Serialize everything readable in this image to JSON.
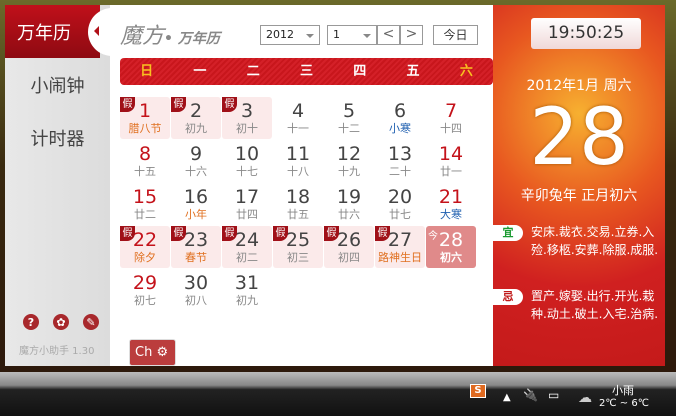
{
  "sidebar": {
    "items": [
      {
        "label": "万年历"
      },
      {
        "label": "小闹钟"
      },
      {
        "label": "计时器"
      }
    ],
    "version": "魔方小助手 1.30"
  },
  "header": {
    "logo": "魔方",
    "logo_sub": "• 万年历",
    "year": "2012",
    "month": "1",
    "prev": "<",
    "next": ">",
    "today": "今日"
  },
  "weekdays": [
    "日",
    "一",
    "二",
    "三",
    "四",
    "五",
    "六"
  ],
  "holiday_badge": "假",
  "today_badge": "今",
  "days": [
    {
      "d": "1",
      "l": "腊八节",
      "t": "fest",
      "hol": true,
      "red": true
    },
    {
      "d": "2",
      "l": "初九",
      "hol": true
    },
    {
      "d": "3",
      "l": "初十",
      "hol": true
    },
    {
      "d": "4",
      "l": "十一"
    },
    {
      "d": "5",
      "l": "十二"
    },
    {
      "d": "6",
      "l": "小寒",
      "t": "term"
    },
    {
      "d": "7",
      "l": "十四",
      "red": true
    },
    {
      "d": "8",
      "l": "十五",
      "red": true
    },
    {
      "d": "9",
      "l": "十六"
    },
    {
      "d": "10",
      "l": "十七"
    },
    {
      "d": "11",
      "l": "十八"
    },
    {
      "d": "12",
      "l": "十九"
    },
    {
      "d": "13",
      "l": "二十"
    },
    {
      "d": "14",
      "l": "廿一",
      "red": true
    },
    {
      "d": "15",
      "l": "廿二",
      "red": true
    },
    {
      "d": "16",
      "l": "小年",
      "t": "fest"
    },
    {
      "d": "17",
      "l": "廿四"
    },
    {
      "d": "18",
      "l": "廿五"
    },
    {
      "d": "19",
      "l": "廿六"
    },
    {
      "d": "20",
      "l": "廿七"
    },
    {
      "d": "21",
      "l": "大寒",
      "t": "term",
      "red": true
    },
    {
      "d": "22",
      "l": "除夕",
      "t": "fest",
      "hol": true,
      "red": true
    },
    {
      "d": "23",
      "l": "春节",
      "t": "fest",
      "hol": true
    },
    {
      "d": "24",
      "l": "初二",
      "hol": true
    },
    {
      "d": "25",
      "l": "初三",
      "hol": true
    },
    {
      "d": "26",
      "l": "初四",
      "hol": true
    },
    {
      "d": "27",
      "l": "路神生日",
      "t": "fest",
      "hol": true
    },
    {
      "d": "28",
      "l": "初六",
      "today": true
    },
    {
      "d": "29",
      "l": "初七",
      "red": true
    },
    {
      "d": "30",
      "l": "初八"
    },
    {
      "d": "31",
      "l": "初九"
    }
  ],
  "right": {
    "clock": "19:50:25",
    "year_month": "2012年1月  周六",
    "day": "28",
    "lunar": "辛卯兔年 正月初六",
    "yi_label": "宜",
    "yi": "安床.裁衣.交易.立券.入殓.移柩.安葬.除服.成服.",
    "ji_label": "忌",
    "ji": "置产.嫁娶.出行.开光.栽种.动土.破土.入宅.治病.",
    "ch": "Ch"
  },
  "taskbar": {
    "weather": "小雨",
    "temp": "2℃ ~ 6℃"
  }
}
